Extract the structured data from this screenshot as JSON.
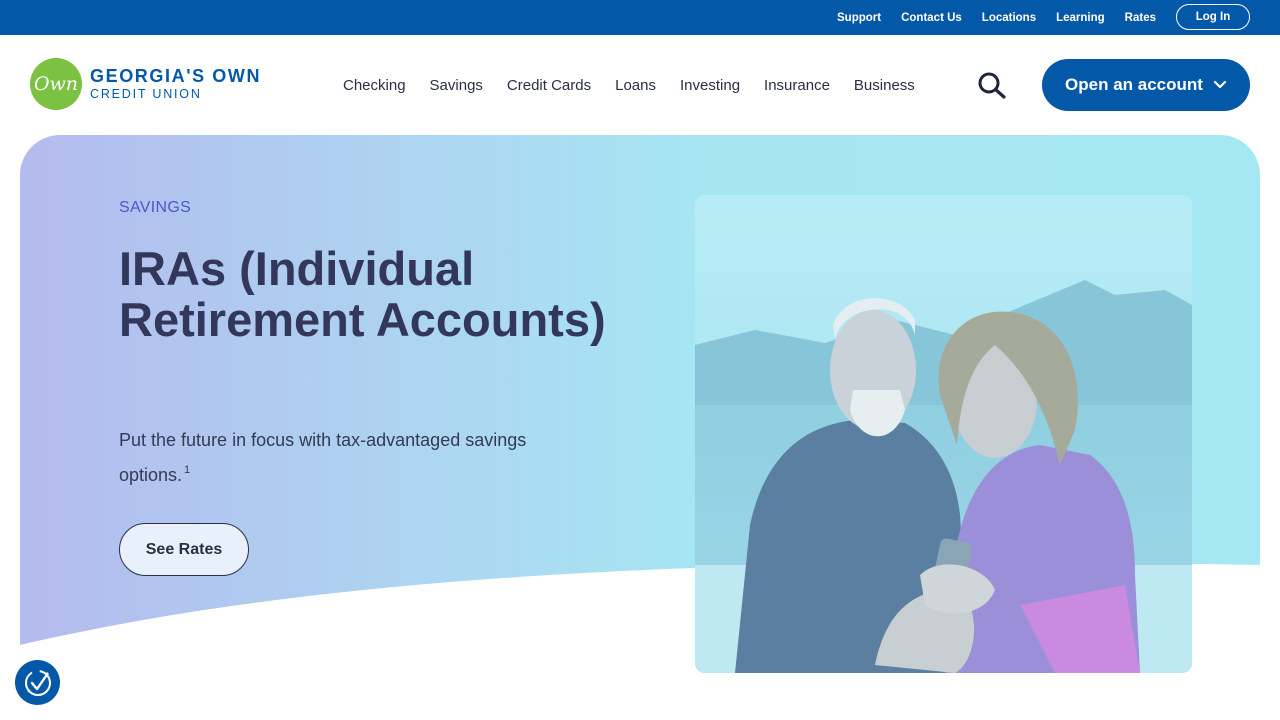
{
  "utility_nav": {
    "links": [
      "Support",
      "Contact Us",
      "Locations",
      "Learning",
      "Rates"
    ],
    "login_label": "Log In"
  },
  "logo": {
    "badge_text": "Own",
    "line1": "GEORGIA'S OWN",
    "line2": "CREDIT UNION"
  },
  "main_nav": {
    "items": [
      "Checking",
      "Savings",
      "Credit Cards",
      "Loans",
      "Investing",
      "Insurance",
      "Business"
    ],
    "search_icon": "search-icon",
    "open_account_label": "Open an account",
    "open_account_icon": "chevron-down-icon"
  },
  "hero": {
    "eyebrow": "SAVINGS",
    "title": "IRAs (Individual Retirement Accounts)",
    "subtitle": "Put the future in focus with tax-advantaged savings options.",
    "footnote": "1",
    "cta_label": "See Rates"
  },
  "accessibility": {
    "icon": "accessibility-icon"
  },
  "colors": {
    "brand_blue": "#0458a8",
    "logo_green": "#7cc242",
    "heading_navy": "#33375a",
    "eyebrow_blue": "#4a58c8"
  }
}
